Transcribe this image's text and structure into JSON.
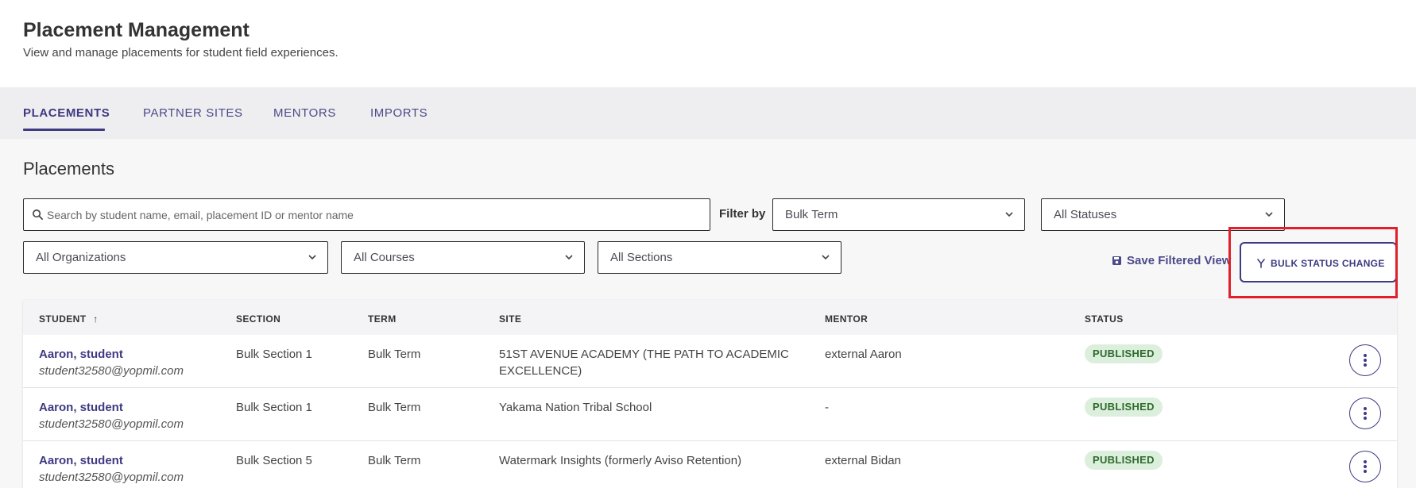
{
  "header": {
    "title": "Placement Management",
    "subtitle": "View and manage placements for student field experiences."
  },
  "tabs": [
    {
      "label": "PLACEMENTS",
      "active": true
    },
    {
      "label": "PARTNER SITES",
      "active": false
    },
    {
      "label": "MENTORS",
      "active": false
    },
    {
      "label": "IMPORTS",
      "active": false
    }
  ],
  "main": {
    "section_title": "Placements",
    "search": {
      "placeholder": "Search by student name, email, placement ID or mentor name",
      "value": ""
    },
    "filter_label": "Filter by",
    "filters": {
      "term": "Bulk Term",
      "status": "All Statuses",
      "organization": "All Organizations",
      "course": "All Courses",
      "section": "All Sections"
    },
    "save_view_label": "Save Filtered View",
    "bulk_button_label": "BULK STATUS CHANGE"
  },
  "table": {
    "columns": [
      "STUDENT",
      "SECTION",
      "TERM",
      "SITE",
      "MENTOR",
      "STATUS"
    ],
    "sort_indicator": "↑",
    "rows": [
      {
        "student_name": "Aaron, student",
        "student_email": "student32580@yopmil.com",
        "section": "Bulk Section 1",
        "term": "Bulk Term",
        "site_line1": "51ST AVENUE ACADEMY (THE PATH TO ACADEMIC",
        "site_line2": "EXCELLENCE)",
        "mentor": "external Aaron",
        "status": "PUBLISHED"
      },
      {
        "student_name": "Aaron, student",
        "student_email": "student32580@yopmil.com",
        "section": "Bulk Section 1",
        "term": "Bulk Term",
        "site_line1": "Yakama Nation Tribal School",
        "site_line2": "",
        "mentor": "-",
        "status": "PUBLISHED"
      },
      {
        "student_name": "Aaron, student",
        "student_email": "student32580@yopmil.com",
        "section": "Bulk Section 5",
        "term": "Bulk Term",
        "site_line1": "Watermark Insights (formerly Aviso Retention)",
        "site_line2": "",
        "mentor": "external Bidan",
        "status": "PUBLISHED"
      }
    ]
  },
  "colors": {
    "accent": "#3d3a82",
    "highlight": "#e0202a",
    "published_bg": "#dcefdc",
    "published_text": "#2f6b2f"
  }
}
